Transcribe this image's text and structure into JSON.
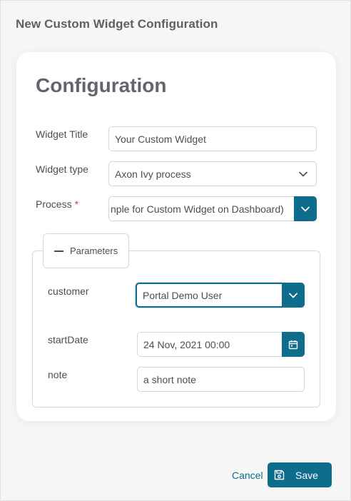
{
  "dialog": {
    "title": "New Custom Widget Configuration"
  },
  "configuration": {
    "heading": "Configuration",
    "widget_title": {
      "label": "Widget Title",
      "value": "Your Custom Widget"
    },
    "widget_type": {
      "label": "Widget type",
      "value": "Axon Ivy process"
    },
    "process": {
      "label": "Process",
      "required_mark": "*",
      "value": "nple for Custom Widget on Dashboard)"
    }
  },
  "parameters": {
    "legend": "Parameters",
    "customer": {
      "label": "customer",
      "value": "Portal Demo User"
    },
    "start_date": {
      "label": "startDate",
      "value": "24 Nov, 2021 00:00"
    },
    "note": {
      "label": "note",
      "value": "a short note"
    }
  },
  "footer": {
    "cancel_label": "Cancel",
    "save_label": "Save"
  },
  "icons": {
    "dropdown": "chevron-down-icon",
    "calendar": "calendar-icon",
    "save": "floppy-disk-icon",
    "collapse": "minus-icon"
  },
  "colors": {
    "accent": "#0e6d8c",
    "required": "#d43a3a"
  }
}
